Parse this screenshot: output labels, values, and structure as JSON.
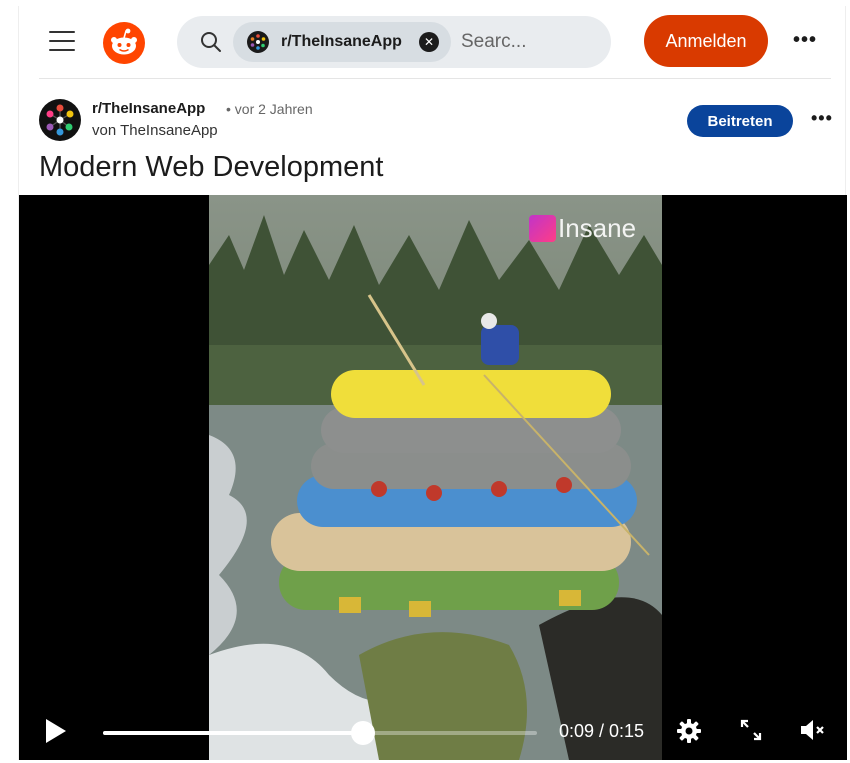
{
  "header": {
    "search": {
      "chip_label": "r/TheInsaneApp",
      "placeholder": "Searc..."
    },
    "signin_label": "Anmelden",
    "more_label": "•••",
    "accent": "#d93a00"
  },
  "post": {
    "subreddit": "r/TheInsaneApp",
    "age": "• vor 2 Jahren",
    "author": "von TheInsaneApp",
    "join_label": "Beitreten",
    "more_label": "•••",
    "title": "Modern Web Development"
  },
  "video": {
    "watermark": "Insane",
    "time": "0:09 / 0:15",
    "progress": 0.6,
    "muted": true
  },
  "icons": [
    "menu-icon",
    "reddit-logo-icon",
    "search-icon",
    "close-icon",
    "play-icon",
    "gear-icon",
    "fullscreen-icon",
    "mute-icon"
  ]
}
